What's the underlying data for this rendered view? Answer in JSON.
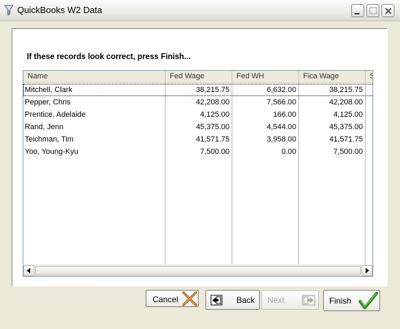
{
  "window": {
    "title": "QuickBooks W2 Data",
    "icon": "funnel-icon"
  },
  "instruction": "If these records look correct, press Finish...",
  "grid": {
    "columns": [
      "Name",
      "Fed Wage",
      "Fed WH",
      "Fica Wage",
      "S"
    ],
    "rows": [
      {
        "name": "Mitchell, Clark",
        "fed_wage": "38,215.75",
        "fed_wh": "6,632.00",
        "fica_wage": "38,215.75"
      },
      {
        "name": "Pepper, Chris",
        "fed_wage": "42,208.00",
        "fed_wh": "7,566.00",
        "fica_wage": "42,208.00"
      },
      {
        "name": "Prentice, Adelaide",
        "fed_wage": "4,125.00",
        "fed_wh": "166.00",
        "fica_wage": "4,125.00"
      },
      {
        "name": "Rand, Jenn",
        "fed_wage": "45,375.00",
        "fed_wh": "4,544.00",
        "fica_wage": "45,375.00"
      },
      {
        "name": "Teichman, Tim",
        "fed_wage": "41,571.75",
        "fed_wh": "3,958.00",
        "fica_wage": "41,571.75"
      },
      {
        "name": "Yoo, Young-Kyu",
        "fed_wage": "7,500.00",
        "fed_wh": "0.00",
        "fica_wage": "7,500.00"
      }
    ],
    "selected_row": 0
  },
  "buttons": {
    "cancel": "Cancel",
    "back": "Back",
    "next": "Next",
    "finish": "Finish"
  },
  "colors": {
    "window_bg": "#ece9d8",
    "cancel_x": "#b5651d",
    "finish_check": "#2e8b22",
    "disabled_text": "#a7a69d"
  }
}
